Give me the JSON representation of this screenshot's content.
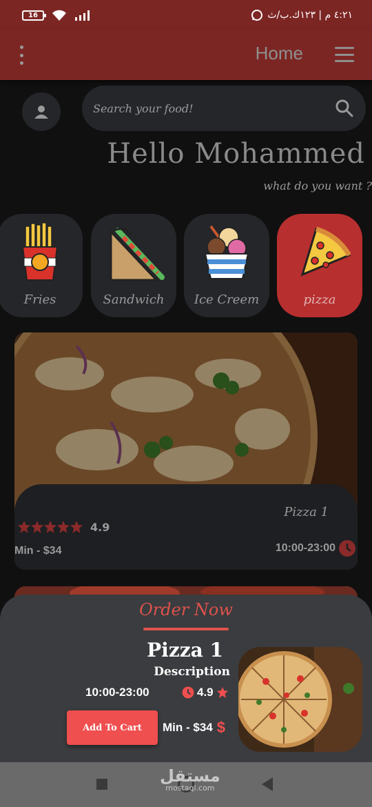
{
  "status_bar": {
    "battery": "16",
    "time_text": "٤:٢١ م | ١٢٣ك.ب/ث"
  },
  "app_bar": {
    "title": "Home"
  },
  "search": {
    "placeholder": "Search your food!"
  },
  "greeting": {
    "title": "Hello Mohammed",
    "subtitle": "what do you want ?"
  },
  "categories": [
    {
      "label": "Fries",
      "icon": "fries-icon",
      "active": false
    },
    {
      "label": "Sandwich",
      "icon": "sandwich-icon",
      "active": false
    },
    {
      "label": "Ice Creem",
      "icon": "ice-cream-icon",
      "active": false
    },
    {
      "label": "pizza",
      "icon": "pizza-icon",
      "active": true
    }
  ],
  "food_card": {
    "name": "Pizza 1",
    "rating": "4.9",
    "stars": 5,
    "min_price": "Min - $34",
    "hours": "10:00-23:00"
  },
  "order_sheet": {
    "title": "Order Now",
    "name": "Pizza 1",
    "description": "Description",
    "hours": "10:00-23:00",
    "rating": "4.9",
    "add_to_cart": "Add To Cart",
    "min_price": "Min - $34",
    "currency_symbol": "$"
  },
  "watermark": {
    "text": "مستقل",
    "sub": "mostaql.com"
  },
  "colors": {
    "primary_red": "#7c2624",
    "accent_red": "#ef4f4f",
    "active_category": "#b82f2f",
    "card_bg": "#24262a"
  }
}
